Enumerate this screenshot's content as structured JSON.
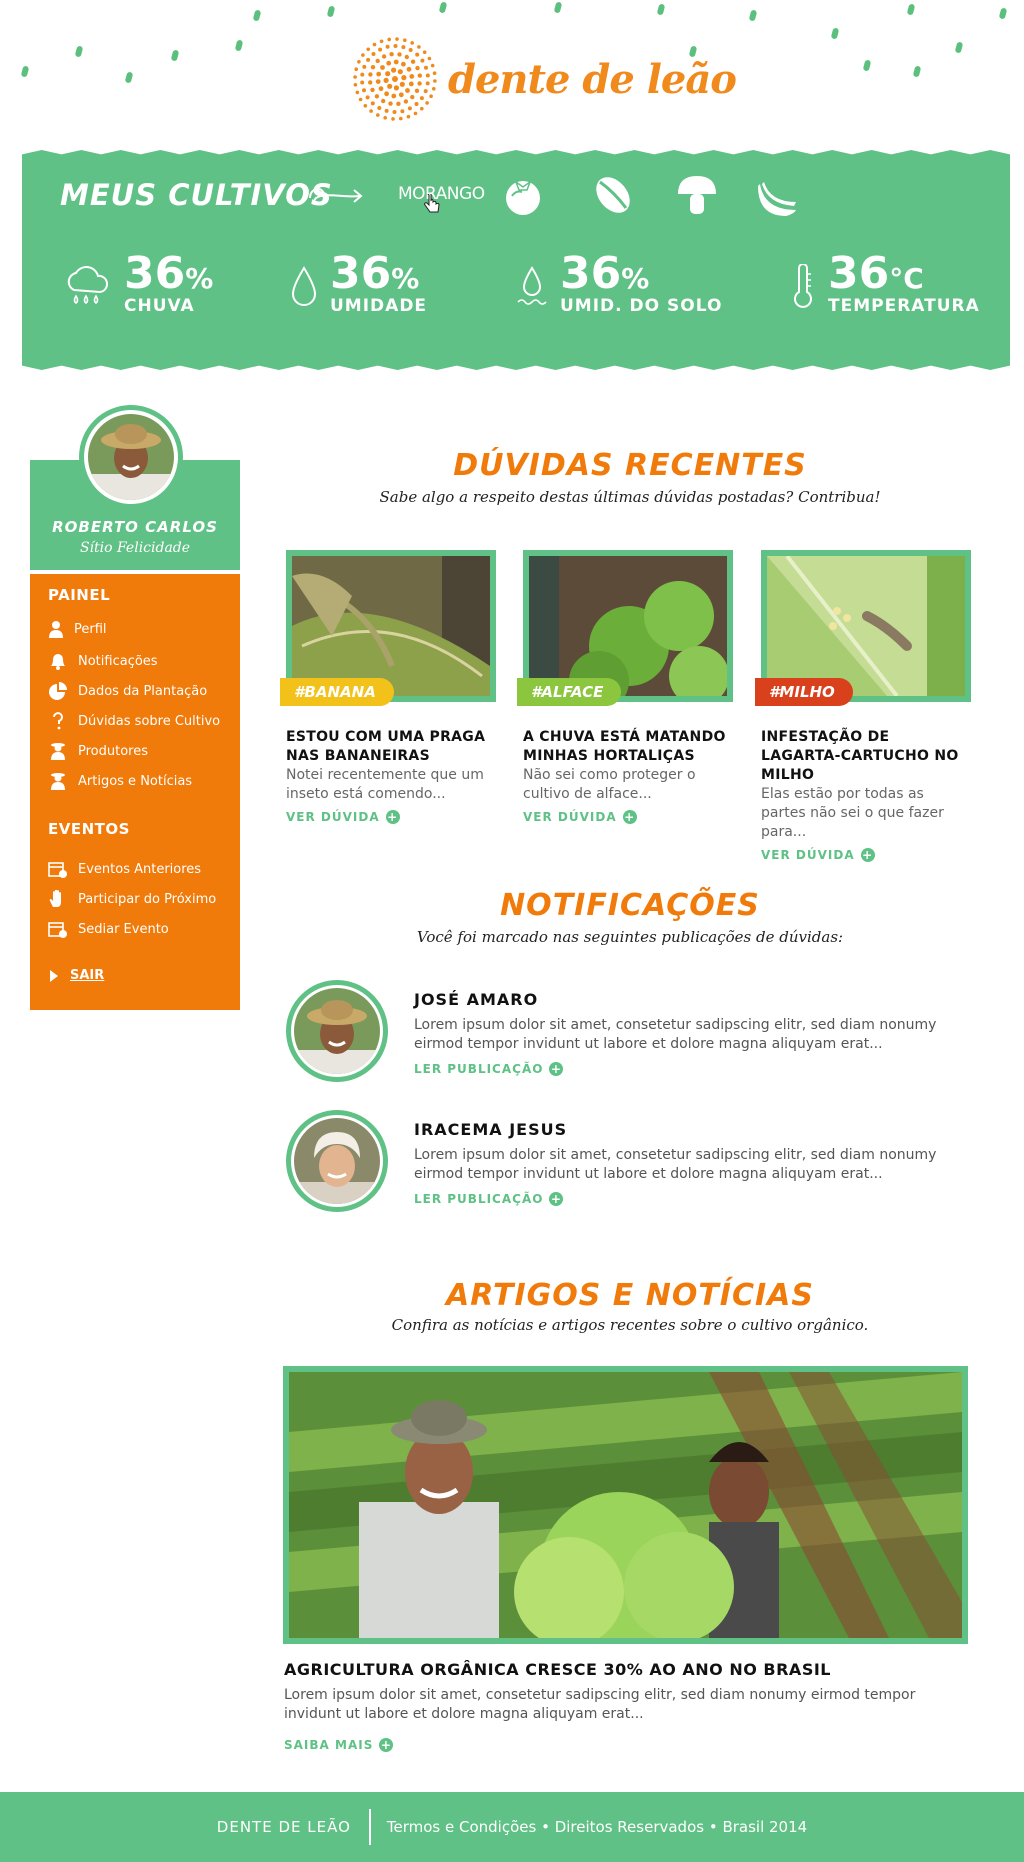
{
  "brand": {
    "name": "dente de leão"
  },
  "banner": {
    "title": "MEUS CULTIVOS",
    "active_crop": "MORANGO",
    "crop_icons": [
      "tomato-icon",
      "coffee-bean-icon",
      "mushroom-icon",
      "banana-icon"
    ],
    "stats": [
      {
        "icon": "rain-cloud-icon",
        "value": "36",
        "unit": "%",
        "label": "CHUVA"
      },
      {
        "icon": "water-drop-icon",
        "value": "36",
        "unit": "%",
        "label": "UMIDADE"
      },
      {
        "icon": "soil-moisture-icon",
        "value": "36",
        "unit": "%",
        "label": "UMID. DO SOLO"
      },
      {
        "icon": "thermometer-icon",
        "value": "36",
        "unit": "°C",
        "label": "TEMPERATURA"
      }
    ]
  },
  "profile": {
    "name": "ROBERTO CARLOS",
    "place": "Sítio Felicidade"
  },
  "sidebar": {
    "painel_heading": "PAINEL",
    "painel_items": [
      {
        "icon": "user-icon",
        "label": "Perfil"
      },
      {
        "icon": "bell-icon",
        "label": "Notificações"
      },
      {
        "icon": "pie-chart-icon",
        "label": "Dados da Plantação"
      },
      {
        "icon": "question-icon",
        "label": "Dúvidas sobre Cultivo"
      },
      {
        "icon": "farmer-icon",
        "label": "Produtores"
      },
      {
        "icon": "article-icon",
        "label": "Artigos e Notícias"
      }
    ],
    "eventos_heading": "EVENTOS",
    "eventos_items": [
      {
        "icon": "calendar-icon",
        "label": "Eventos Anteriores"
      },
      {
        "icon": "hand-icon",
        "label": "Participar do Próximo"
      },
      {
        "icon": "calendar-add-icon",
        "label": "Sediar Evento"
      }
    ],
    "logout": "SAIR"
  },
  "questions": {
    "title": "DÚVIDAS RECENTES",
    "subtitle": "Sabe algo a respeito destas últimas dúvidas postadas? Contribua!",
    "link_label": "VER DÚVIDA",
    "items": [
      {
        "tag": "#BANANA",
        "tag_color": "#f2c21b",
        "title": "ESTOU COM UMA PRAGA NAS BANANEIRAS",
        "text": "Notei recentemente que um inseto está comendo..."
      },
      {
        "tag": "#ALFACE",
        "tag_color": "#8cc63f",
        "title": "A CHUVA ESTÁ MATANDO MINHAS HORTALIÇAS",
        "text": "Não sei como proteger o cultivo de alface..."
      },
      {
        "tag": "#MILHO",
        "tag_color": "#d9401c",
        "title": "INFESTAÇÃO DE LAGARTA-CARTUCHO NO MILHO",
        "text": "Elas estão por todas as partes não sei o que fazer para..."
      }
    ]
  },
  "notifications": {
    "title": "NOTIFICAÇÕES",
    "subtitle": "Você foi marcado nas seguintes publicações de dúvidas:",
    "link_label": "LER PUBLICAÇÃO",
    "items": [
      {
        "name": "JOSÉ AMARO",
        "text": "Lorem ipsum dolor sit amet, consetetur sadipscing elitr, sed diam nonumy eirmod tempor invidunt ut labore et dolore magna aliquyam erat..."
      },
      {
        "name": "IRACEMA JESUS",
        "text": "Lorem ipsum dolor sit amet, consetetur sadipscing elitr, sed diam nonumy eirmod tempor invidunt ut labore et dolore magna aliquyam erat..."
      }
    ]
  },
  "articles": {
    "title": "ARTIGOS E NOTÍCIAS",
    "subtitle": "Confira as notícias e artigos recentes sobre o cultivo orgânico.",
    "headline": "AGRICULTURA ORGÂNICA CRESCE 30% AO ANO NO BRASIL",
    "text": "Lorem ipsum dolor sit amet, consetetur sadipscing elitr, sed diam nonumy eirmod tempor invidunt ut labore et dolore magna aliquyam erat...",
    "link_label": "SAIBA MAIS"
  },
  "footer": {
    "brand": "DENTE DE LEÃO",
    "legal": "Termos e Condições • Direitos Reservados • Brasil 2014"
  },
  "colors": {
    "green": "#5fc185",
    "orange": "#f07a0a",
    "logo_orange": "#f08a1d"
  }
}
